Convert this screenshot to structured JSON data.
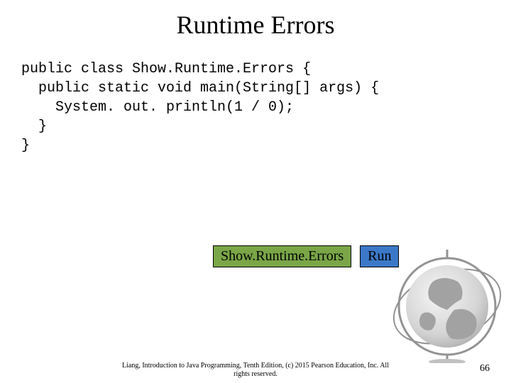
{
  "title": "Runtime Errors",
  "code": {
    "line1": "public class Show.Runtime.Errors {",
    "line2": "  public static void main(String[] args) {",
    "line3": "    System. out. println(1 / 0);",
    "line4": "  }",
    "line5": "}"
  },
  "buttons": {
    "show_label": "Show.Runtime.Errors",
    "run_label": "Run"
  },
  "footer": {
    "line1": "Liang, Introduction to Java Programming, Tenth Edition, (c) 2015 Pearson Education, Inc. All",
    "line2": "rights reserved."
  },
  "page_number": "66"
}
